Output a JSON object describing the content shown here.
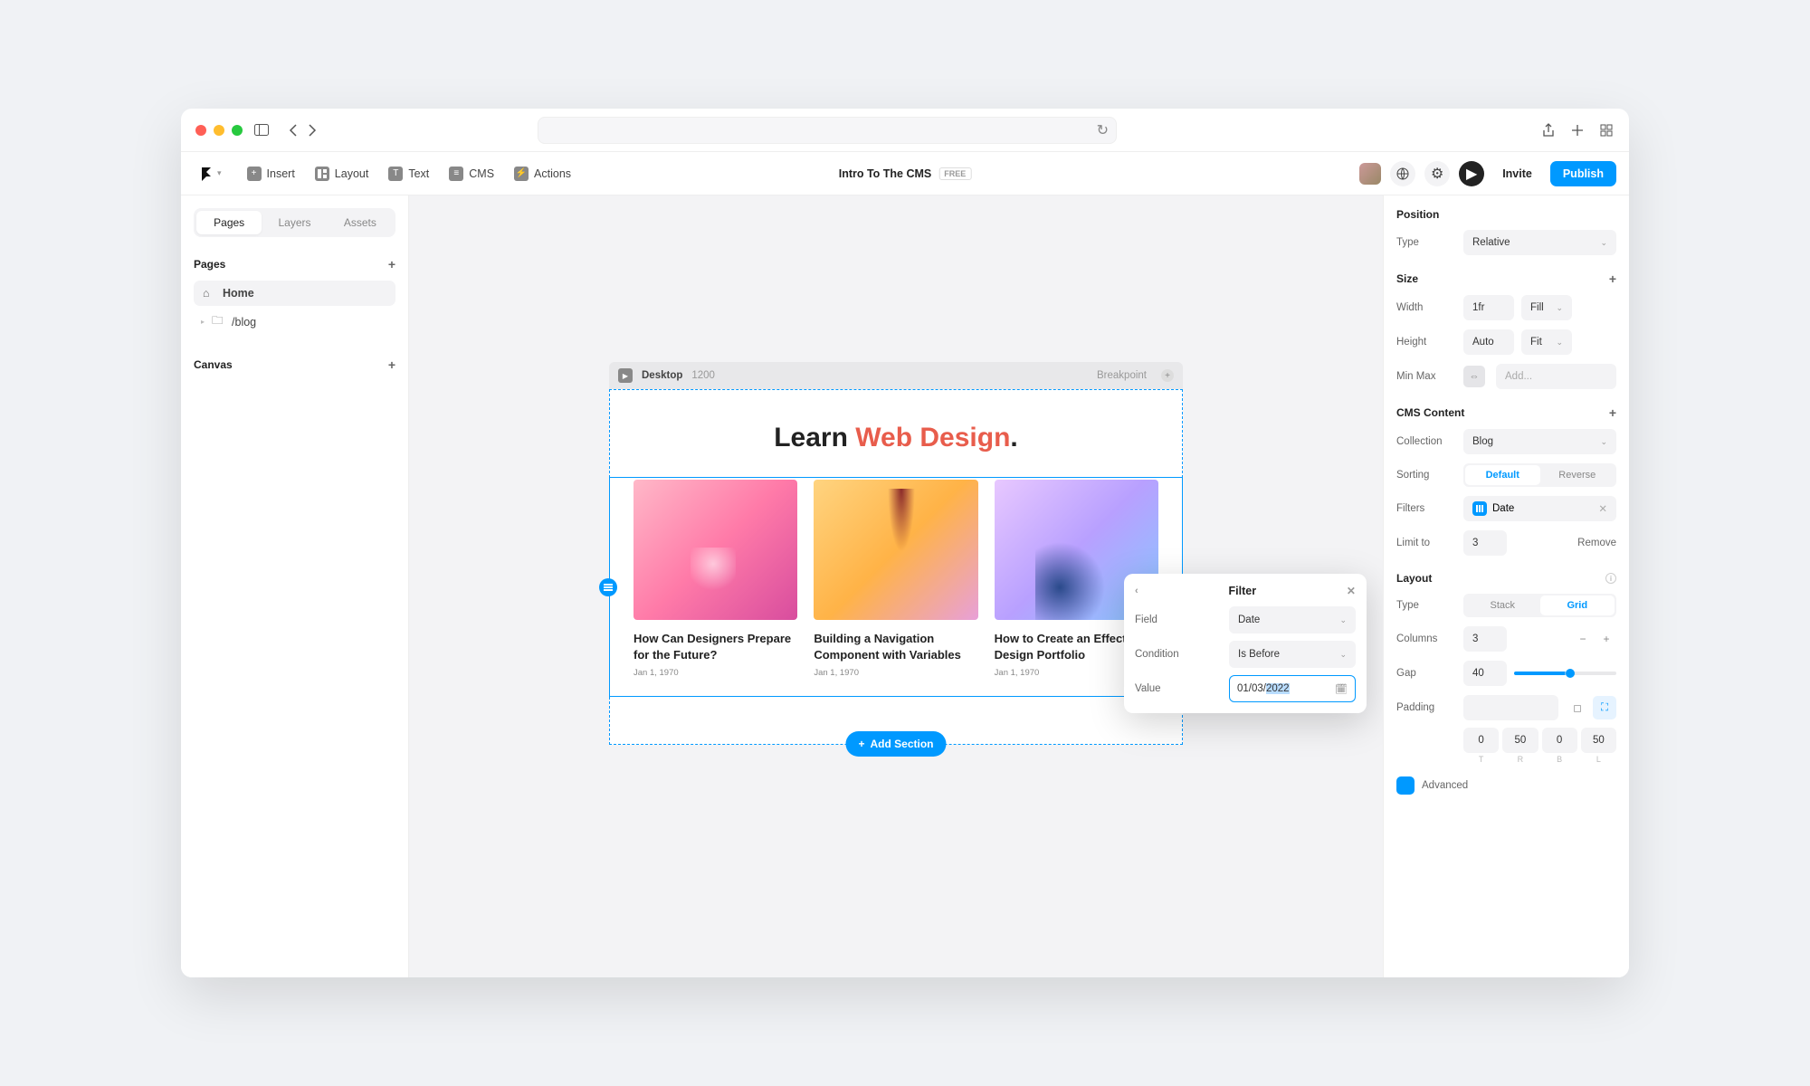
{
  "toolbar": {
    "insert": "Insert",
    "layout": "Layout",
    "text": "Text",
    "cms": "CMS",
    "actions": "Actions",
    "title": "Intro To The CMS",
    "badge": "FREE",
    "invite": "Invite",
    "publish": "Publish"
  },
  "leftPanel": {
    "tabs": {
      "pages": "Pages",
      "layers": "Layers",
      "assets": "Assets"
    },
    "pagesHeader": "Pages",
    "canvasHeader": "Canvas",
    "items": [
      {
        "label": "Home"
      },
      {
        "label": "/blog"
      }
    ]
  },
  "viewport": {
    "device": "Desktop",
    "width": "1200",
    "breakpoint": "Breakpoint"
  },
  "preview": {
    "heroPre": "Learn ",
    "heroAccent": "Web Design",
    "heroPost": ".",
    "addSection": "Add Section",
    "cards": [
      {
        "title": "How Can Designers Prepare for the Future?",
        "date": "Jan 1, 1970"
      },
      {
        "title": "Building a Navigation Component with Variables",
        "date": "Jan 1, 1970"
      },
      {
        "title": "How to Create an Effective Design Portfolio",
        "date": "Jan 1, 1970"
      }
    ]
  },
  "filterPopover": {
    "title": "Filter",
    "fieldLabel": "Field",
    "fieldValue": "Date",
    "conditionLabel": "Condition",
    "conditionValue": "Is Before",
    "valueLabel": "Value",
    "valuePre": "01/03/",
    "valueSel": "2022"
  },
  "rightPanel": {
    "position": {
      "title": "Position",
      "typeLabel": "Type",
      "typeValue": "Relative"
    },
    "size": {
      "title": "Size",
      "widthLabel": "Width",
      "widthValue": "1fr",
      "widthMode": "Fill",
      "heightLabel": "Height",
      "heightValue": "Auto",
      "heightMode": "Fit",
      "minmaxLabel": "Min Max",
      "minmaxPlaceholder": "Add..."
    },
    "cms": {
      "title": "CMS Content",
      "collectionLabel": "Collection",
      "collectionValue": "Blog",
      "sortingLabel": "Sorting",
      "sortDefault": "Default",
      "sortReverse": "Reverse",
      "filtersLabel": "Filters",
      "filtersValue": "Date",
      "limitLabel": "Limit to",
      "limitValue": "3",
      "limitRemove": "Remove"
    },
    "layout": {
      "title": "Layout",
      "typeLabel": "Type",
      "typeStack": "Stack",
      "typeGrid": "Grid",
      "columnsLabel": "Columns",
      "columnsValue": "3",
      "gapLabel": "Gap",
      "gapValue": "40",
      "paddingLabel": "Padding",
      "paddingValues": [
        "0",
        "50",
        "0",
        "50"
      ],
      "paddingLetters": [
        "T",
        "R",
        "B",
        "L"
      ],
      "advanced": "Advanced"
    }
  }
}
